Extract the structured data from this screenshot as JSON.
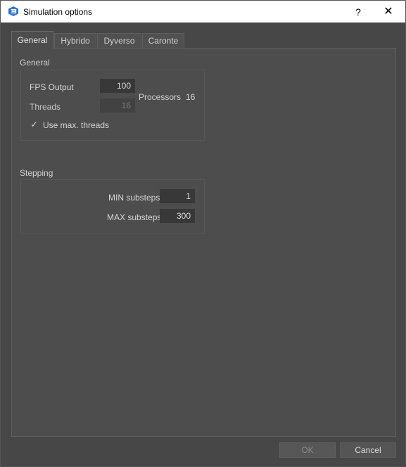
{
  "window": {
    "title": "Simulation options",
    "help_label": "?",
    "close_label": "✕"
  },
  "tabs": [
    {
      "label": "General",
      "active": true
    },
    {
      "label": "Hybrido",
      "active": false
    },
    {
      "label": "Dyverso",
      "active": false
    },
    {
      "label": "Caronte",
      "active": false
    }
  ],
  "general": {
    "title": "General",
    "fps_label": "FPS Output",
    "fps_value": "100",
    "threads_label": "Threads",
    "threads_value": "16",
    "processors_label": "Processors",
    "processors_value": "16",
    "use_max_threads_label": "Use max. threads",
    "use_max_threads_checked": true,
    "check_glyph": "✓"
  },
  "stepping": {
    "title": "Stepping",
    "min_label": "MIN substeps",
    "min_value": "1",
    "max_label": "MAX substeps",
    "max_value": "300"
  },
  "footer": {
    "ok_label": "OK",
    "cancel_label": "Cancel"
  },
  "colors": {
    "accent_icon": "#2f6fd0",
    "background": "#474747"
  }
}
